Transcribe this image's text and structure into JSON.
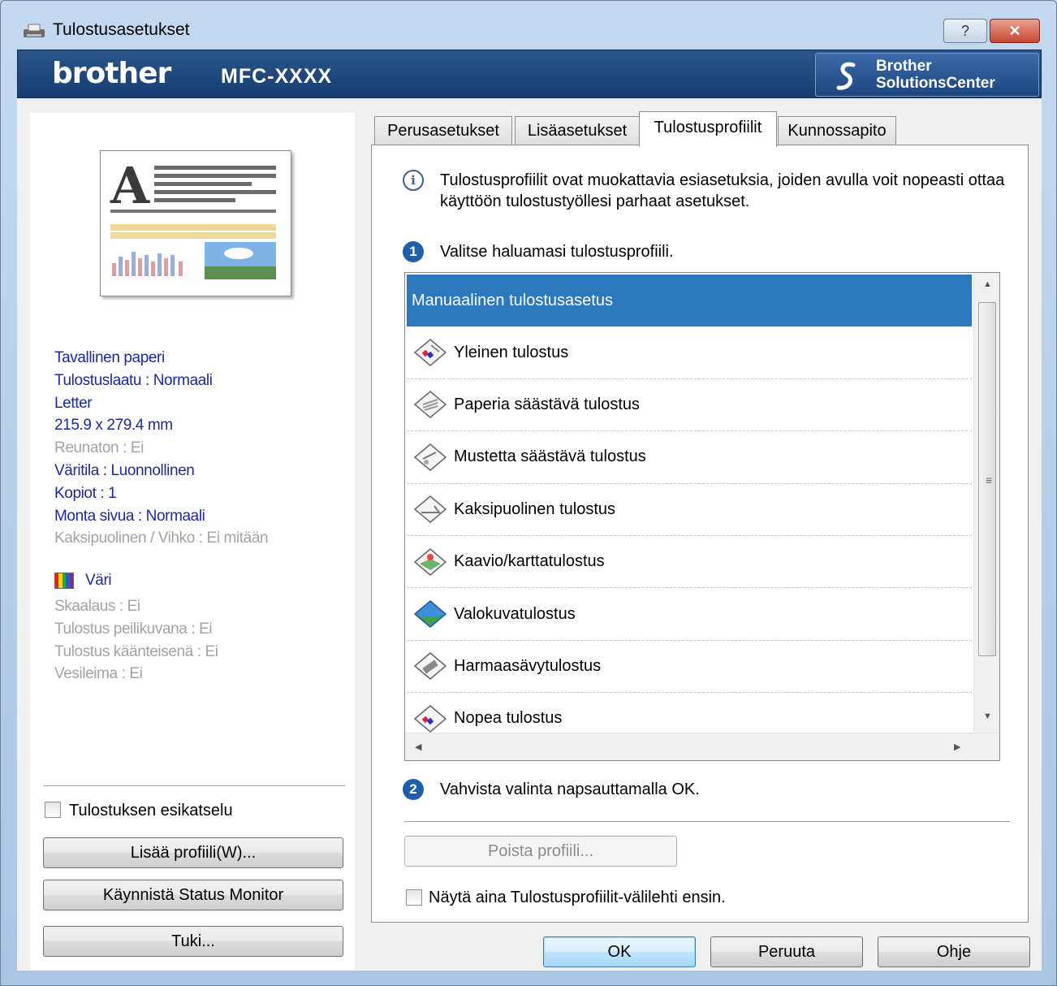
{
  "window": {
    "title": "Tulostusasetukset",
    "help_button": "?",
    "close_button": "✕"
  },
  "banner": {
    "brand": "brother",
    "model": "MFC-XXXX",
    "solutions_line1": "Brother",
    "solutions_line2": "SolutionsCenter"
  },
  "left_panel": {
    "settings": [
      "Tavallinen paperi",
      "Tulostuslaatu : Normaali",
      "Letter",
      "215.9 x 279.4 mm",
      "Reunaton : Ei",
      "Väritila : Luonnollinen",
      "Kopiot : 1",
      "Monta sivua : Normaali",
      "Kaksipuolinen / Vihko : Ei mitään"
    ],
    "color_label": "Väri",
    "settings2": [
      "Skaalaus : Ei",
      "Tulostus peilikuvana : Ei",
      "Tulostus käänteisenä : Ei",
      "Vesileima : Ei"
    ],
    "preview_checkbox": "Tulostuksen esikatselu",
    "add_profile_button": "Lisää profiili(W)...",
    "status_monitor_button": "Käynnistä Status Monitor",
    "support_button": "Tuki..."
  },
  "tabs": [
    {
      "label": "Perusasetukset"
    },
    {
      "label": "Lisäasetukset"
    },
    {
      "label": "Tulostusprofiilit"
    },
    {
      "label": "Kunnossapito"
    }
  ],
  "content": {
    "info_text": "Tulostusprofiilit ovat muokattavia esiasetuksia, joiden avulla voit nopeasti ottaa käyttöön tulostustyöllesi parhaat asetukset.",
    "step1_number": "1",
    "step1_text": "Valitse haluamasi tulostusprofiili.",
    "profiles": [
      {
        "label": "Manuaalinen tulostusasetus",
        "icon": "none",
        "selected": true
      },
      {
        "label": "Yleinen tulostus",
        "icon": "general-print-icon"
      },
      {
        "label": "Paperia säästävä tulostus",
        "icon": "paper-save-icon"
      },
      {
        "label": "Mustetta säästävä tulostus",
        "icon": "ink-save-icon"
      },
      {
        "label": "Kaksipuolinen tulostus",
        "icon": "duplex-icon"
      },
      {
        "label": "Kaavio/karttatulostus",
        "icon": "chart-map-icon"
      },
      {
        "label": "Valokuvatulostus",
        "icon": "photo-icon"
      },
      {
        "label": "Harmaasävytulostus",
        "icon": "grayscale-icon"
      },
      {
        "label": "Nopea tulostus",
        "icon": "fast-print-icon"
      }
    ],
    "step2_number": "2",
    "step2_text": "Vahvista valinta napsauttamalla OK.",
    "delete_profile_button": "Poista profiili...",
    "always_show_checkbox": "Näytä aina Tulostusprofiilit-välilehti ensin."
  },
  "footer": {
    "ok": "OK",
    "cancel": "Peruuta",
    "help": "Ohje"
  },
  "colors": {
    "selection": "#2c78bd",
    "banner": "#1f4a82",
    "active_setting_text": "#1a2aa0"
  }
}
